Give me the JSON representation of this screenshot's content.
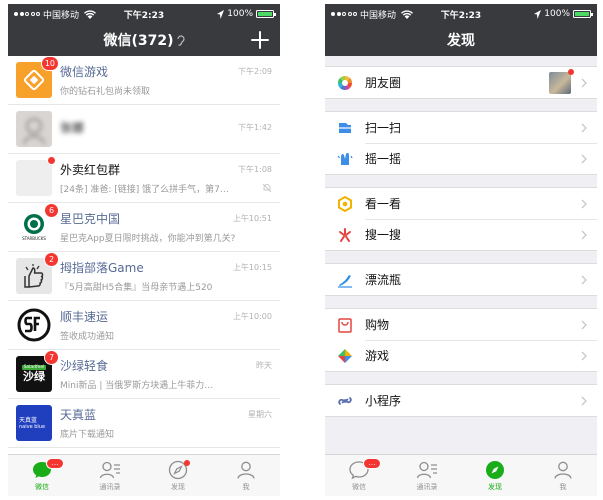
{
  "colors": {
    "titlebar": "#393a3e",
    "accent": "#1aad19",
    "badge": "#f43530",
    "link": "#576b95"
  },
  "status": {
    "carrier": "中国移动",
    "time": "下午2:23",
    "battery": "100%",
    "battery_level": 100
  },
  "chats_screen": {
    "title": "微信(372)",
    "items": [
      {
        "name": "微信游戏",
        "message": "你的钻石礼包尚未领取",
        "time": "下午2:09",
        "badge": "10",
        "avatar_icon": "game-diamond-icon"
      },
      {
        "name": "张娜",
        "message": "",
        "time": "下午1:42",
        "badge": "",
        "avatar_icon": "portrait-sketch-icon"
      },
      {
        "name": "外卖红包群",
        "message": "[24条] 准爸: [链接] 饿了么拼手气，第7…",
        "time": "下午1:08",
        "badge": "dot",
        "avatar_icon": "group-grid-icon",
        "muted": true
      },
      {
        "name": "星巴克中国",
        "message": "星巴克App夏日限时挑战，你能冲到第几关?",
        "time": "上午10:51",
        "badge": "6",
        "avatar_icon": "starbucks-logo-icon"
      },
      {
        "name": "拇指部落Game",
        "message": "『5月高甜H5合集』当母亲节遇上520",
        "time": "上午10:15",
        "badge": "2",
        "avatar_icon": "thumb-tribe-icon"
      },
      {
        "name": "顺丰速运",
        "message": "签收成功通知",
        "time": "上午10:00",
        "badge": "",
        "avatar_icon": "sf-express-logo-icon"
      },
      {
        "name": "沙绿轻食",
        "message": "Mini新品 | 当俄罗斯方块遇上牛菲力…",
        "time": "昨天",
        "badge": "7",
        "avatar_icon": "saladfeel-logo-icon",
        "avatar_caption": "沙绿",
        "avatar_top": "Saladfeel"
      },
      {
        "name": "天真蓝",
        "message": "底片下载通知",
        "time": "星期六",
        "badge": "",
        "avatar_icon": "naive-blue-logo-icon",
        "avatar_caption": "天真蓝",
        "avatar_sub": "naive blue"
      }
    ]
  },
  "discover_screen": {
    "title": "发现",
    "groups": [
      [
        {
          "label": "朋友圈",
          "icon": "moments-icon"
        }
      ],
      [
        {
          "label": "扫一扫",
          "icon": "scan-icon"
        },
        {
          "label": "摇一摇",
          "icon": "shake-icon"
        }
      ],
      [
        {
          "label": "看一看",
          "icon": "top-stories-icon"
        },
        {
          "label": "搜一搜",
          "icon": "search-icon"
        }
      ],
      [
        {
          "label": "漂流瓶",
          "icon": "drift-bottle-icon"
        }
      ],
      [
        {
          "label": "购物",
          "icon": "shopping-icon"
        },
        {
          "label": "游戏",
          "icon": "games-icon"
        }
      ],
      [
        {
          "label": "小程序",
          "icon": "mini-programs-icon"
        }
      ]
    ]
  },
  "tabbar": {
    "tabs": [
      {
        "label": "微信",
        "icon": "chats-icon",
        "badge": "…"
      },
      {
        "label": "通讯录",
        "icon": "contacts-icon"
      },
      {
        "label": "发现",
        "icon": "discover-compass-icon",
        "dot": true
      },
      {
        "label": "我",
        "icon": "me-icon"
      }
    ]
  }
}
